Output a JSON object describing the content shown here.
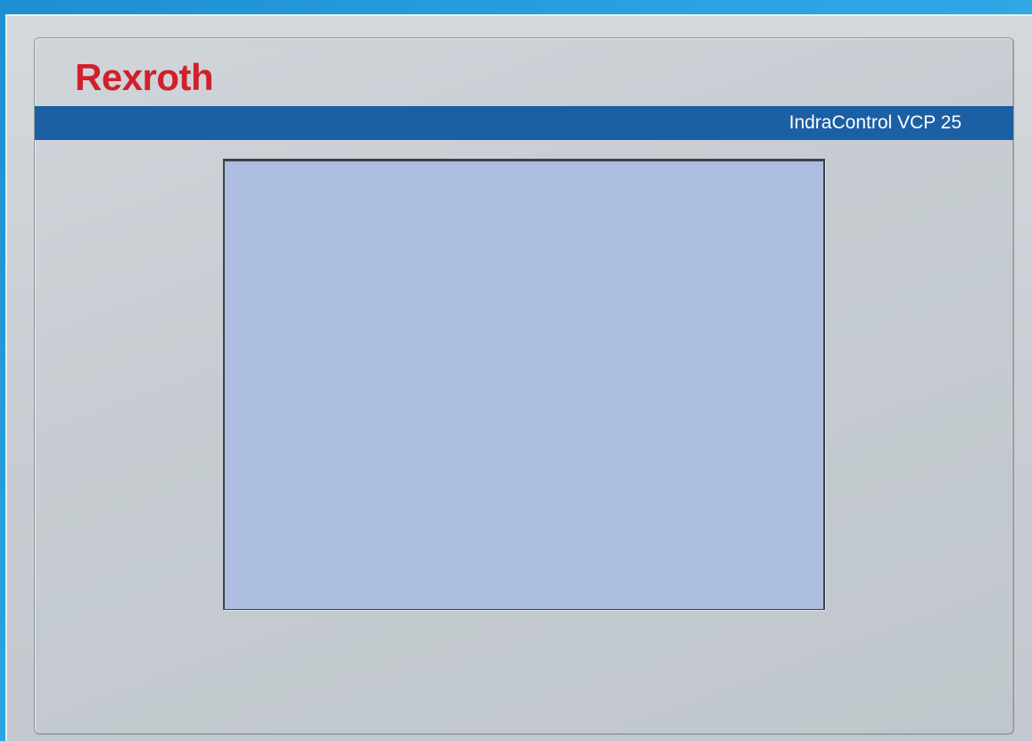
{
  "device": {
    "brand": "Rexroth",
    "model": "IndraControl VCP 25"
  },
  "colors": {
    "background": "#2aa3e2",
    "bezel": "#c8ced3",
    "brand_red": "#d0202a",
    "band_blue": "#1b5fa4",
    "screen": "#adbde0"
  }
}
